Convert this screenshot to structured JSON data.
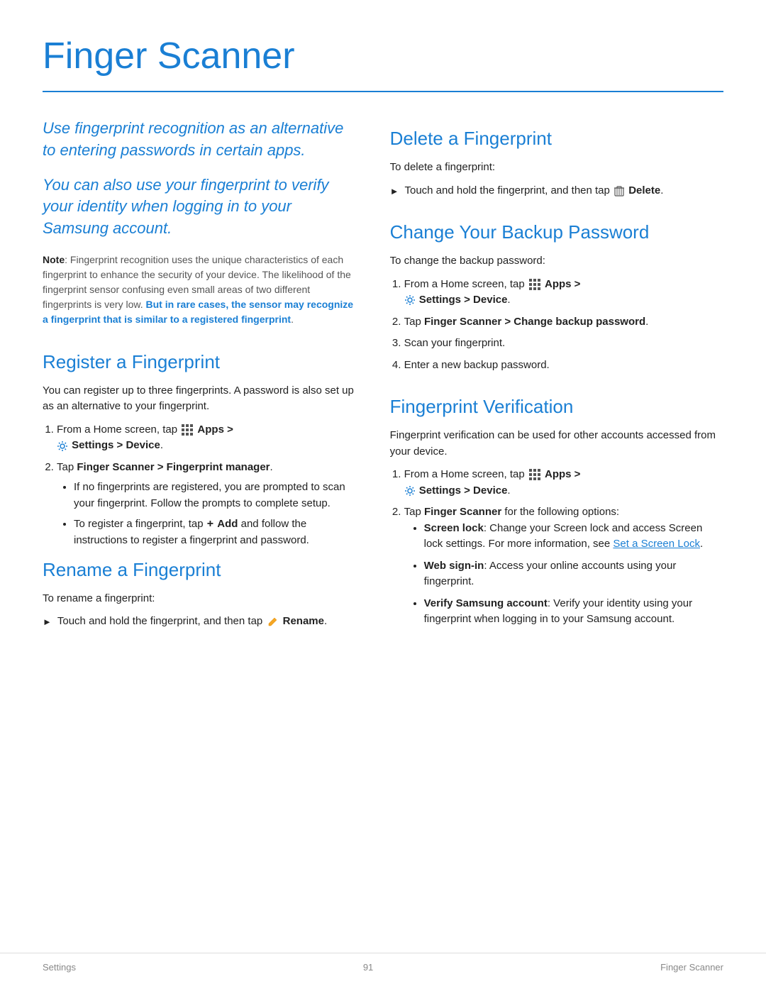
{
  "page": {
    "title": "Finger Scanner",
    "footer_left": "Settings",
    "footer_center": "91",
    "footer_right": "Finger Scanner"
  },
  "intro": {
    "para1": "Use fingerprint recognition as an alternative to entering passwords in certain apps.",
    "para2": "You can also use your fingerprint to verify your identity when logging in to your Samsung account.",
    "note_label": "Note",
    "note_text": ": Fingerprint recognition uses the unique characteristics of each fingerprint to enhance the security of your device. The likelihood of the fingerprint sensor confusing even small areas of two different fingerprints is very low. ",
    "note_warning": "But in rare cases, the sensor may recognize a fingerprint that is similar to a registered fingerprint",
    "note_warning_end": "."
  },
  "register": {
    "title": "Register a Fingerprint",
    "intro": "You can register up to three fingerprints. A password is also set up as an alternative to your fingerprint.",
    "steps": [
      {
        "text_before_icon": "From a Home screen, tap ",
        "apps_icon": true,
        "text_bold": "Apps >",
        "gear_icon": true,
        "text_bold2": "Settings > Device",
        "text_end": "."
      },
      {
        "text": "Tap ",
        "bold": "Finger Scanner > Fingerprint manager",
        "text_end": "."
      }
    ],
    "sub_bullets": [
      "If no fingerprints are registered, you are prompted to scan your fingerprint. Follow the prompts to complete setup.",
      "To register a fingerprint, tap"
    ],
    "sub_bullet2_bold": "Add",
    "sub_bullet2_end": " and follow the instructions to register a fingerprint and password."
  },
  "rename": {
    "title": "Rename a Fingerprint",
    "intro": "To rename a fingerprint:",
    "arrow_text_before": "Touch and hold the fingerprint, and then tap ",
    "arrow_bold": "Rename",
    "arrow_end": "."
  },
  "delete": {
    "title": "Delete a Fingerprint",
    "intro": "To delete a fingerprint:",
    "arrow_text_before": "Touch and hold the fingerprint, and then tap ",
    "arrow_bold": "Delete",
    "arrow_end": "."
  },
  "change_backup": {
    "title": "Change Your Backup Password",
    "intro": "To change the backup password:",
    "steps": [
      {
        "text_before_icon": "From a Home screen, tap ",
        "apps_icon": true,
        "text_bold": "Apps >",
        "gear_icon": true,
        "text_bold2": "Settings > Device",
        "text_end": "."
      },
      {
        "text": "Tap ",
        "bold": "Finger Scanner > Change backup password",
        "text_end": "."
      },
      {
        "text": "Scan your fingerprint.",
        "plain": true
      },
      {
        "text": "Enter a new backup password.",
        "plain": true
      }
    ]
  },
  "fingerprint_verification": {
    "title": "Fingerprint Verification",
    "intro": "Fingerprint verification can be used for other accounts accessed from your device.",
    "steps": [
      {
        "text_before_icon": "From a Home screen, tap ",
        "apps_icon": true,
        "text_bold": "Apps >",
        "gear_icon": true,
        "text_bold2": "Settings > Device",
        "text_end": "."
      },
      {
        "text": "Tap ",
        "bold": "Finger Scanner",
        "text_end": " for the following options:"
      }
    ],
    "bullets": [
      {
        "bold": "Screen lock",
        "text": ": Change your Screen lock and access Screen lock settings. For more information, see ",
        "link": "Set a Screen Lock",
        "text_end": "."
      },
      {
        "bold": "Web sign-in",
        "text": ": Access your online accounts using your fingerprint.",
        "text_end": ""
      },
      {
        "bold": "Verify Samsung account",
        "text": ": Verify your identity using your fingerprint when logging in to your Samsung account.",
        "text_end": ""
      }
    ]
  }
}
